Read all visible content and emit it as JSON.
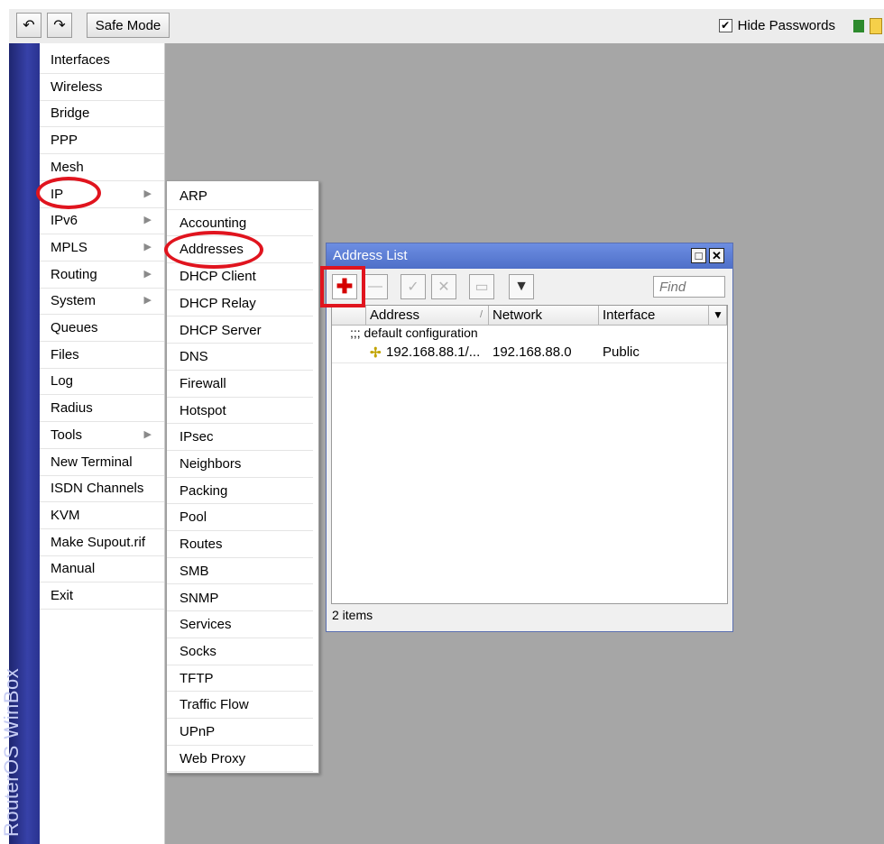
{
  "toolbar": {
    "undo_icon": "undo-icon",
    "redo_icon": "redo-icon",
    "undo_glyph": "↶",
    "redo_glyph": "↷",
    "safe_mode_label": "Safe Mode",
    "hide_passwords_label": "Hide Passwords",
    "hide_passwords_checked": "✔"
  },
  "brand": "RouterOS WinBox",
  "main_menu": [
    {
      "label": "Interfaces",
      "has_submenu": false
    },
    {
      "label": "Wireless",
      "has_submenu": false
    },
    {
      "label": "Bridge",
      "has_submenu": false
    },
    {
      "label": "PPP",
      "has_submenu": false
    },
    {
      "label": "Mesh",
      "has_submenu": false
    },
    {
      "label": "IP",
      "has_submenu": true
    },
    {
      "label": "IPv6",
      "has_submenu": true
    },
    {
      "label": "MPLS",
      "has_submenu": true
    },
    {
      "label": "Routing",
      "has_submenu": true
    },
    {
      "label": "System",
      "has_submenu": true
    },
    {
      "label": "Queues",
      "has_submenu": false
    },
    {
      "label": "Files",
      "has_submenu": false
    },
    {
      "label": "Log",
      "has_submenu": false
    },
    {
      "label": "Radius",
      "has_submenu": false
    },
    {
      "label": "Tools",
      "has_submenu": true
    },
    {
      "label": "New Terminal",
      "has_submenu": false
    },
    {
      "label": "ISDN Channels",
      "has_submenu": false
    },
    {
      "label": "KVM",
      "has_submenu": false
    },
    {
      "label": "Make Supout.rif",
      "has_submenu": false
    },
    {
      "label": "Manual",
      "has_submenu": false
    },
    {
      "label": "Exit",
      "has_submenu": false
    }
  ],
  "submenu_arrow": "▶",
  "ip_submenu": [
    "ARP",
    "Accounting",
    "Addresses",
    "DHCP Client",
    "DHCP Relay",
    "DHCP Server",
    "DNS",
    "Firewall",
    "Hotspot",
    "IPsec",
    "Neighbors",
    "Packing",
    "Pool",
    "Routes",
    "SMB",
    "SNMP",
    "Services",
    "Socks",
    "TFTP",
    "Traffic Flow",
    "UPnP",
    "Web Proxy"
  ],
  "address_window": {
    "title": "Address List",
    "max_glyph": "□",
    "close_glyph": "✕",
    "buttons": {
      "add": "✚",
      "remove": "—",
      "enable": "✓",
      "disable": "✕",
      "comment": "▭",
      "filter": "▼"
    },
    "find_placeholder": "Find",
    "columns": [
      "Address",
      "Network",
      "Interface"
    ],
    "sort_glyph": "/",
    "dropdown_glyph": "▼",
    "comment_row": ";;; default configuration",
    "rows": [
      {
        "icon": "✢",
        "address": "192.168.88.1/...",
        "network": "192.168.88.0",
        "interface": "Public"
      }
    ],
    "status": "2 items"
  },
  "colors": {
    "highlight": "#e0141e",
    "title_bar": "#5a7bd6",
    "brand_bar": "#2f3796"
  }
}
